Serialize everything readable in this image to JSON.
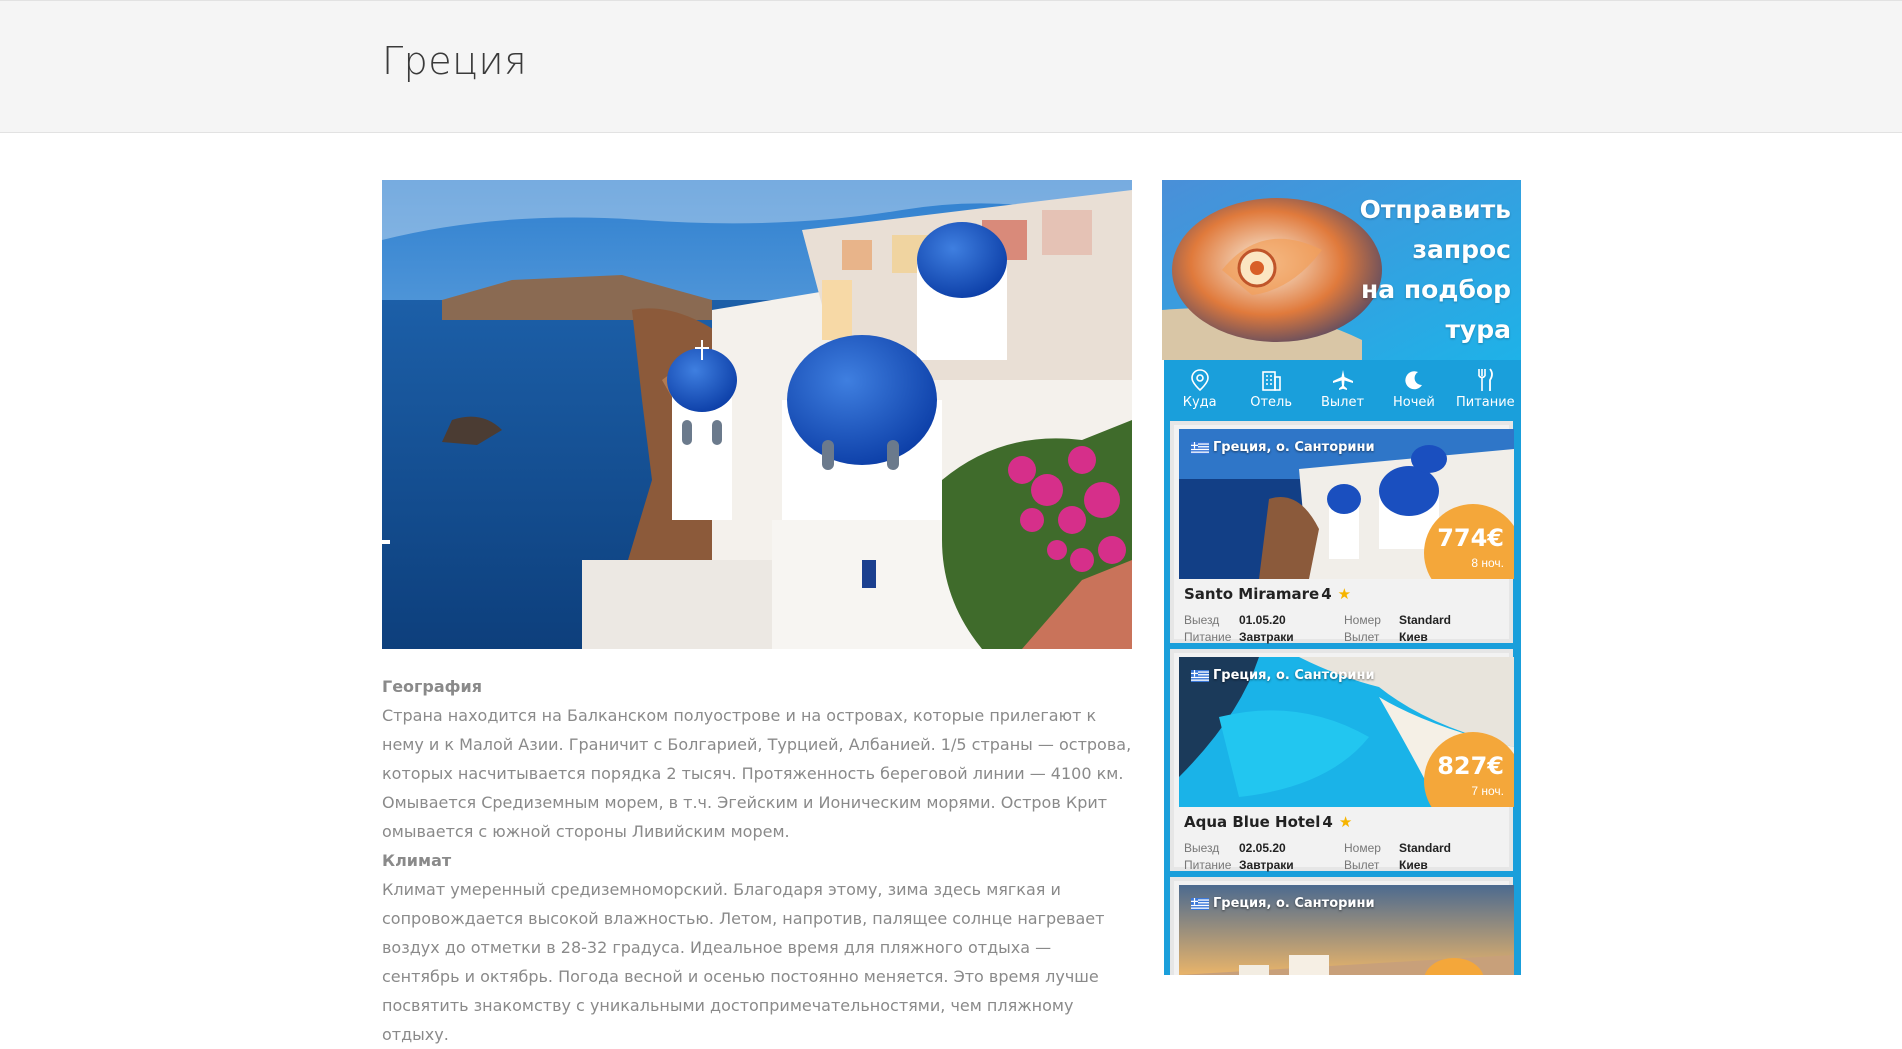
{
  "page": {
    "title": "Греция"
  },
  "article": {
    "geo_title": "География",
    "geo_text": "Страна находится на Балканском полуострове и на островах, которые прилегают к нему и к Малой Азии. Граничит с Болгарией, Турцией, Албанией. 1/5 страны — острова, которых насчитывается порядка 2 тысяч. Протяженность береговой линии — 4100 км. Омывается Средиземным морем, в т.ч. Эгейским и Ионическим морями. Остров Крит омывается с южной стороны Ливийским морем.",
    "climate_title": "Климат",
    "climate_text": "Климат умеренный средиземноморский. Благодаря этому, зима здесь мягкая и сопровождается высокой влажностью. Летом, напротив, палящее солнце нагревает воздух до отметки в 28-32 градуса. Идеальное время для пляжного отдыха — сентябрь и октябрь. Погода весной и осенью постоянно меняется. Это время лучше посвятить знакомству с уникальными достопримечательностями, чем пляжному отдыху."
  },
  "promo": {
    "line1": "Отправить",
    "line2": "запрос",
    "line3": "на подбор",
    "line4": "тура"
  },
  "filters": [
    {
      "label": "Куда",
      "icon": "map-pin-icon"
    },
    {
      "label": "Отель",
      "icon": "building-icon"
    },
    {
      "label": "Вылет",
      "icon": "airplane-icon"
    },
    {
      "label": "Ночей",
      "icon": "moon-icon"
    },
    {
      "label": "Питание",
      "icon": "fork-knife-icon"
    }
  ],
  "tours": [
    {
      "location": "Греция, о. Санторини",
      "price": "774€",
      "nights": "8 ноч.",
      "hotel": "Santo Miramare",
      "stars": "4",
      "departure_label": "Выезд",
      "departure": "01.05.20",
      "room_label": "Номер",
      "room": "Standard",
      "meal_label": "Питание",
      "meal": "Завтраки",
      "flight_label": "Вылет",
      "flight": "Киев"
    },
    {
      "location": "Греция, о. Санторини",
      "price": "827€",
      "nights": "7 ноч.",
      "hotel": "Aqua Blue Hotel",
      "stars": "4",
      "departure_label": "Выезд",
      "departure": "02.05.20",
      "room_label": "Номер",
      "room": "Standard",
      "meal_label": "Питание",
      "meal": "Завтраки",
      "flight_label": "Вылет",
      "flight": "Киев"
    },
    {
      "location": "Греция, о. Санторини"
    }
  ],
  "colors": {
    "accent": "#1a9fdb",
    "price": "#f4a73a",
    "star": "#f6b400"
  }
}
